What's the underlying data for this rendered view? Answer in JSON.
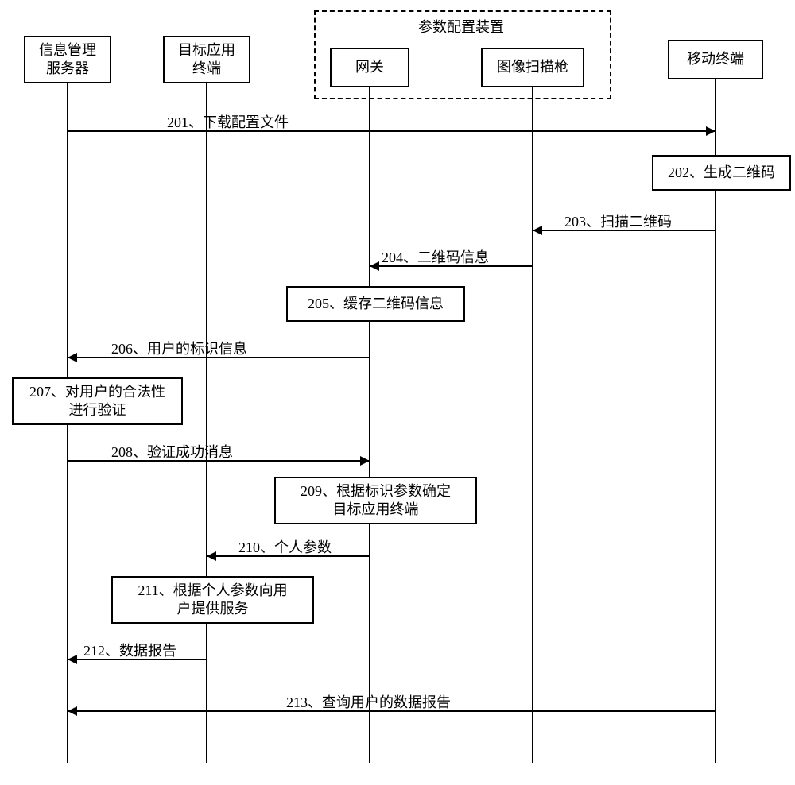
{
  "group_label": "参数配置装置",
  "actors": {
    "info_server": "信息管理\n服务器",
    "target_term": "目标应用\n终端",
    "gateway": "网关",
    "scanner": "图像扫描枪",
    "mobile": "移动终端"
  },
  "messages": {
    "m201": "201、下载配置文件",
    "m202": "202、生成二维码",
    "m203": "203、扫描二维码",
    "m204": "204、二维码信息",
    "m205": "205、缓存二维码信息",
    "m206": "206、用户的标识信息",
    "m207": "207、对用户的合法性\n进行验证",
    "m208": "208、验证成功消息",
    "m209": "209、根据标识参数确定\n目标应用终端",
    "m210": "210、个人参数",
    "m211": "211、根据个人参数向用\n户提供服务",
    "m212": "212、数据报告",
    "m213": "213、查询用户的数据报告"
  },
  "chart_data": {
    "type": "sequence-diagram",
    "group": {
      "label": "参数配置装置",
      "members": [
        "gateway",
        "scanner"
      ]
    },
    "actors": [
      {
        "id": "info_server",
        "label": "信息管理服务器"
      },
      {
        "id": "target_term",
        "label": "目标应用终端"
      },
      {
        "id": "gateway",
        "label": "网关"
      },
      {
        "id": "scanner",
        "label": "图像扫描枪"
      },
      {
        "id": "mobile",
        "label": "移动终端"
      }
    ],
    "steps": [
      {
        "n": 201,
        "from": "info_server",
        "to": "mobile",
        "text": "下载配置文件"
      },
      {
        "n": 202,
        "at": "mobile",
        "text": "生成二维码"
      },
      {
        "n": 203,
        "from": "mobile",
        "to": "scanner",
        "text": "扫描二维码"
      },
      {
        "n": 204,
        "from": "scanner",
        "to": "gateway",
        "text": "二维码信息"
      },
      {
        "n": 205,
        "at": "gateway",
        "text": "缓存二维码信息"
      },
      {
        "n": 206,
        "from": "gateway",
        "to": "info_server",
        "text": "用户的标识信息"
      },
      {
        "n": 207,
        "at": "info_server",
        "text": "对用户的合法性进行验证"
      },
      {
        "n": 208,
        "from": "info_server",
        "to": "gateway",
        "text": "验证成功消息"
      },
      {
        "n": 209,
        "at": "gateway",
        "text": "根据标识参数确定目标应用终端"
      },
      {
        "n": 210,
        "from": "gateway",
        "to": "target_term",
        "text": "个人参数"
      },
      {
        "n": 211,
        "at": "target_term",
        "text": "根据个人参数向用户提供服务"
      },
      {
        "n": 212,
        "from": "target_term",
        "to": "info_server",
        "text": "数据报告"
      },
      {
        "n": 213,
        "from": "mobile",
        "to": "info_server",
        "text": "查询用户的数据报告"
      }
    ]
  }
}
